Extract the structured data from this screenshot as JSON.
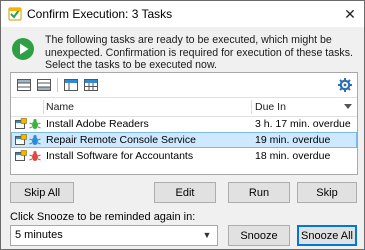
{
  "window": {
    "title": "Confirm Execution: 3 Tasks",
    "close_glyph": "✕"
  },
  "message": "The following tasks are ready to be executed, which might be unexpected. Confirmation is required for execution of these tasks. Select the tasks to be executed now.",
  "toolbar": {
    "icons": [
      "expand-rows-icon",
      "collapse-rows-icon",
      "view-icon",
      "grid-view-icon",
      "settings-gear-icon"
    ]
  },
  "table": {
    "columns": {
      "name": "Name",
      "due": "Due In"
    },
    "rows": [
      {
        "name": "Install Adobe Readers",
        "due": "3 h. 17 min. overdue",
        "selected": false,
        "bug_color": "#3cb043"
      },
      {
        "name": "Repair Remote Console Service",
        "due": "19 min. overdue",
        "selected": true,
        "bug_color": "#2e8bd6"
      },
      {
        "name": "Install Software for Accountants",
        "due": "18 min. overdue",
        "selected": false,
        "bug_color": "#e04848"
      }
    ]
  },
  "buttons": {
    "skip_all": "Skip All",
    "edit": "Edit",
    "run": "Run",
    "skip": "Skip",
    "snooze": "Snooze",
    "snooze_all": "Snooze All"
  },
  "snooze": {
    "label": "Click Snooze to be reminded again in:",
    "selected": "5 minutes"
  },
  "colors": {
    "accent": "#0078d7",
    "selection": "#cde8ff",
    "play_green": "#2ea043"
  }
}
